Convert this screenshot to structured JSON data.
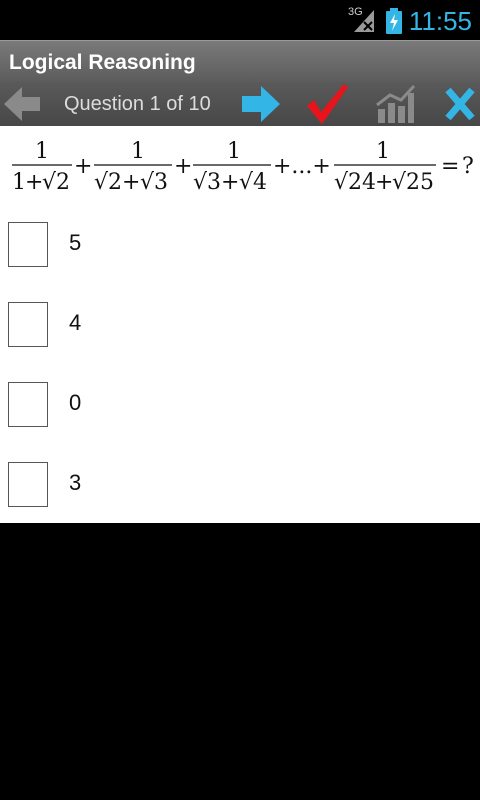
{
  "status_bar": {
    "network_label": "3G",
    "time": "11:55",
    "icons": [
      "signal-icon",
      "battery-charging-icon"
    ],
    "accent_color": "#33b5e5"
  },
  "app": {
    "title": "Logical Reasoning"
  },
  "toolbar": {
    "question_counter": "Question 1 of 10",
    "icons": [
      "previous-arrow-icon",
      "next-arrow-icon",
      "submit-check-icon",
      "stats-chart-icon",
      "close-x-icon"
    ],
    "colors": {
      "arrow": "#33b5e5",
      "check": "#e8141b",
      "close": "#33b5e5"
    }
  },
  "question": {
    "terms": [
      {
        "num": "1",
        "den_a": "1",
        "den_b": "√2"
      },
      {
        "num": "1",
        "den_a": "√2",
        "den_b": "√3"
      },
      {
        "num": "1",
        "den_a": "√3",
        "den_b": "√4"
      },
      {
        "num": "1",
        "den_a": "√24",
        "den_b": "√25"
      }
    ],
    "plus": "+",
    "ellipsis": "+...+",
    "equals": "=",
    "ask": "?"
  },
  "options": [
    {
      "label": "5"
    },
    {
      "label": "4"
    },
    {
      "label": "0"
    },
    {
      "label": "3"
    }
  ]
}
